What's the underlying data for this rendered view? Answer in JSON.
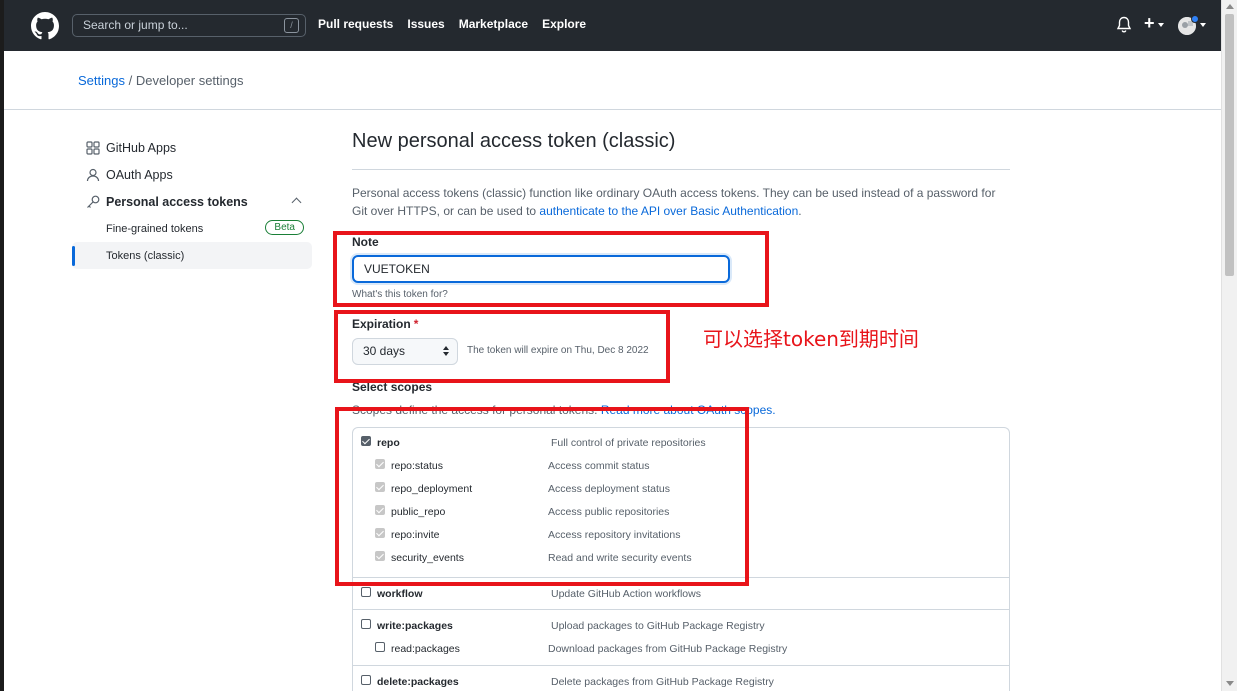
{
  "header": {
    "search_placeholder": "Search or jump to...",
    "search_key": "/",
    "nav": [
      "Pull requests",
      "Issues",
      "Marketplace",
      "Explore"
    ],
    "plus_label": "+"
  },
  "breadcrumb": {
    "link": "Settings",
    "separator": " / ",
    "current": "Developer settings"
  },
  "sidebar": {
    "github_apps": "GitHub Apps",
    "oauth_apps": "OAuth Apps",
    "personal_tokens": "Personal access tokens",
    "fine_grained": "Fine-grained tokens",
    "beta": "Beta",
    "classic": "Tokens (classic)"
  },
  "main": {
    "title": "New personal access token (classic)",
    "desc_1": "Personal access tokens (classic) function like ordinary OAuth access tokens. They can be used instead of a password for Git over HTTPS, or can be used to ",
    "desc_link": "authenticate to the API over Basic Authentication",
    "desc_end": ".",
    "note_label": "Note",
    "note_value": "VUETOKEN",
    "note_hint": "What's this token for?",
    "expiration_label": "Expiration",
    "required_mark": "*",
    "expiration_value": "30 days",
    "expiration_text": "The token will expire on Thu, Dec 8 2022",
    "scopes_label": "Select scopes",
    "scopes_desc": "Scopes define the access for personal tokens. ",
    "scopes_link": "Read more about OAuth scopes."
  },
  "scopes": {
    "repo": {
      "name": "repo",
      "desc": "Full control of private repositories"
    },
    "repo_children": [
      {
        "name": "repo:status",
        "desc": "Access commit status"
      },
      {
        "name": "repo_deployment",
        "desc": "Access deployment status"
      },
      {
        "name": "public_repo",
        "desc": "Access public repositories"
      },
      {
        "name": "repo:invite",
        "desc": "Access repository invitations"
      },
      {
        "name": "security_events",
        "desc": "Read and write security events"
      }
    ],
    "workflow": {
      "name": "workflow",
      "desc": "Update GitHub Action workflows"
    },
    "write_packages": {
      "name": "write:packages",
      "desc": "Upload packages to GitHub Package Registry"
    },
    "read_packages": {
      "name": "read:packages",
      "desc": "Download packages from GitHub Package Registry"
    },
    "delete_packages": {
      "name": "delete:packages",
      "desc": "Delete packages from GitHub Package Registry"
    }
  },
  "annotation": {
    "text": "可以选择token到期时间",
    "color": "#e8141a"
  },
  "colors": {
    "header_bg": "#24292f",
    "link": "#0969da",
    "beta": "#1a7f37"
  }
}
